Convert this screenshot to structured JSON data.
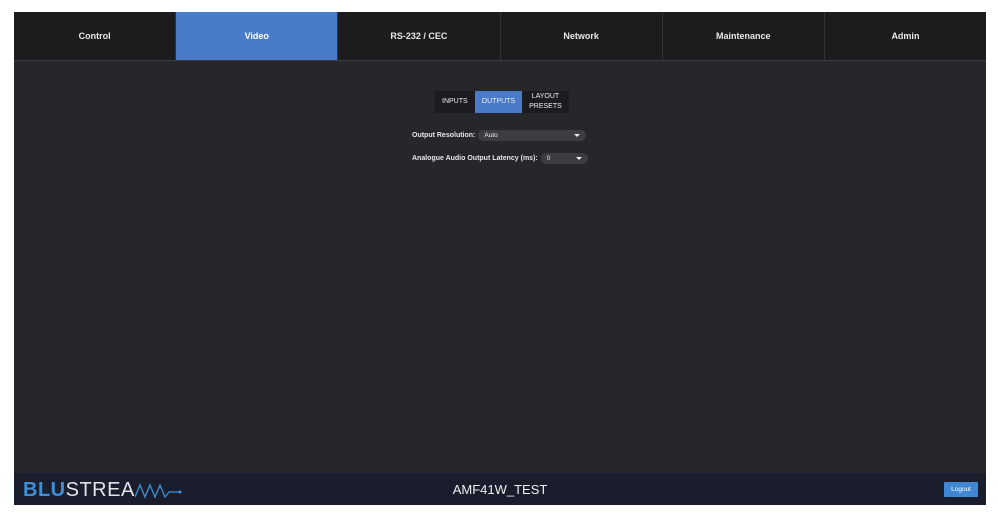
{
  "tabs": [
    {
      "label": "Control"
    },
    {
      "label": "Video"
    },
    {
      "label": "RS-232 / CEC"
    },
    {
      "label": "Network"
    },
    {
      "label": "Maintenance"
    },
    {
      "label": "Admin"
    }
  ],
  "subtabs": {
    "inputs": "INPUTS",
    "outputs": "OUTPUTS",
    "layout1": "LAYOUT",
    "layout2": "PRESETS"
  },
  "settings": {
    "resolution_label": "Output Resolution:",
    "resolution_value": "Auto",
    "latency_label": "Analogue Audio Output Latency (ms):",
    "latency_value": "0"
  },
  "footer": {
    "logo_blu": "BLU",
    "logo_strea": "STREA",
    "device_name": "AMF41W_TEST",
    "logout": "Logout"
  },
  "colors": {
    "accent": "#4a7bc8",
    "logo_blue": "#3f8fd8"
  }
}
